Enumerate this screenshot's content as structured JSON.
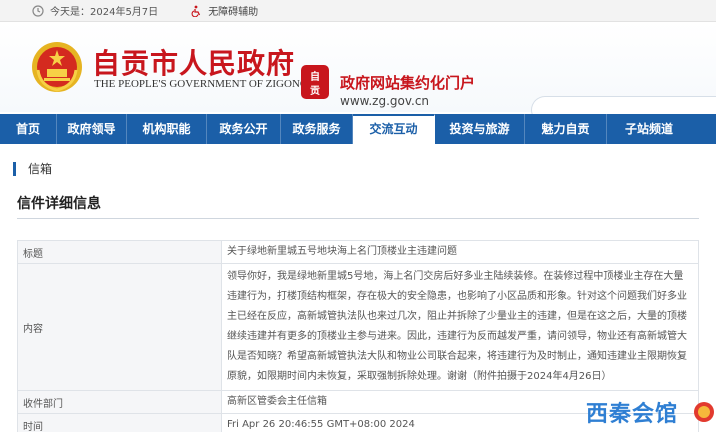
{
  "topbar": {
    "date": "今天是：2024年5月7日",
    "accessibility": "无障碍辅助"
  },
  "header": {
    "title": "自贡市人民政府",
    "subtitle": "THE PEOPLE'S GOVERNMENT OF ZIGONG",
    "seal_text": "自贡",
    "portal_name": "政府网站集约化门户",
    "portal_url": "www.zg.gov.cn"
  },
  "nav": {
    "items": [
      {
        "label": "首页"
      },
      {
        "label": "政府领导"
      },
      {
        "label": "机构职能"
      },
      {
        "label": "政务公开"
      },
      {
        "label": "政务服务"
      },
      {
        "label": "交流互动"
      },
      {
        "label": "投资与旅游"
      },
      {
        "label": "魅力自贡"
      },
      {
        "label": "子站频道"
      }
    ],
    "active": "交流互动"
  },
  "page": {
    "breadcrumb": "信箱",
    "section_title": "信件详细信息"
  },
  "letter": {
    "rows": [
      {
        "label": "标题",
        "value": "关于绿地新里城五号地块海上名门顶楼业主违建问题"
      },
      {
        "label": "内容",
        "value": "领导你好，我是绿地新里城5号地，海上名门交房后好多业主陆续装修。在装修过程中顶楼业主存在大量违建行为，打楼顶结构框架，存在极大的安全隐患，也影响了小区品质和形象。针对这个问题我们好多业主已经在反应，高新城管执法队也来过几次，阻止并拆除了少量业主的违建，但是在这之后，大量的顶楼继续违建并有更多的顶楼业主参与进来。因此，违建行为反而越发严重，请问领导，物业还有高新城管大队是否知晓？希望高新城管执法大队和物业公司联合起来，将违建行为及时制止，通知违建业主限期恢复原貌，如限期时间内未恢复，采取强制拆除处理。谢谢（附件拍摄于2024年4月26日）"
      },
      {
        "label": "收件部门",
        "value": "高新区管委会主任信箱"
      },
      {
        "label": "时间",
        "value": "Fri Apr 26 20:46:55 GMT+08:00 2024"
      }
    ]
  },
  "watermark": "西秦会馆",
  "colors": {
    "brand_red": "#c8161d",
    "nav_blue": "#1b5fa8",
    "watermark_blue": "#2f7fd3"
  }
}
